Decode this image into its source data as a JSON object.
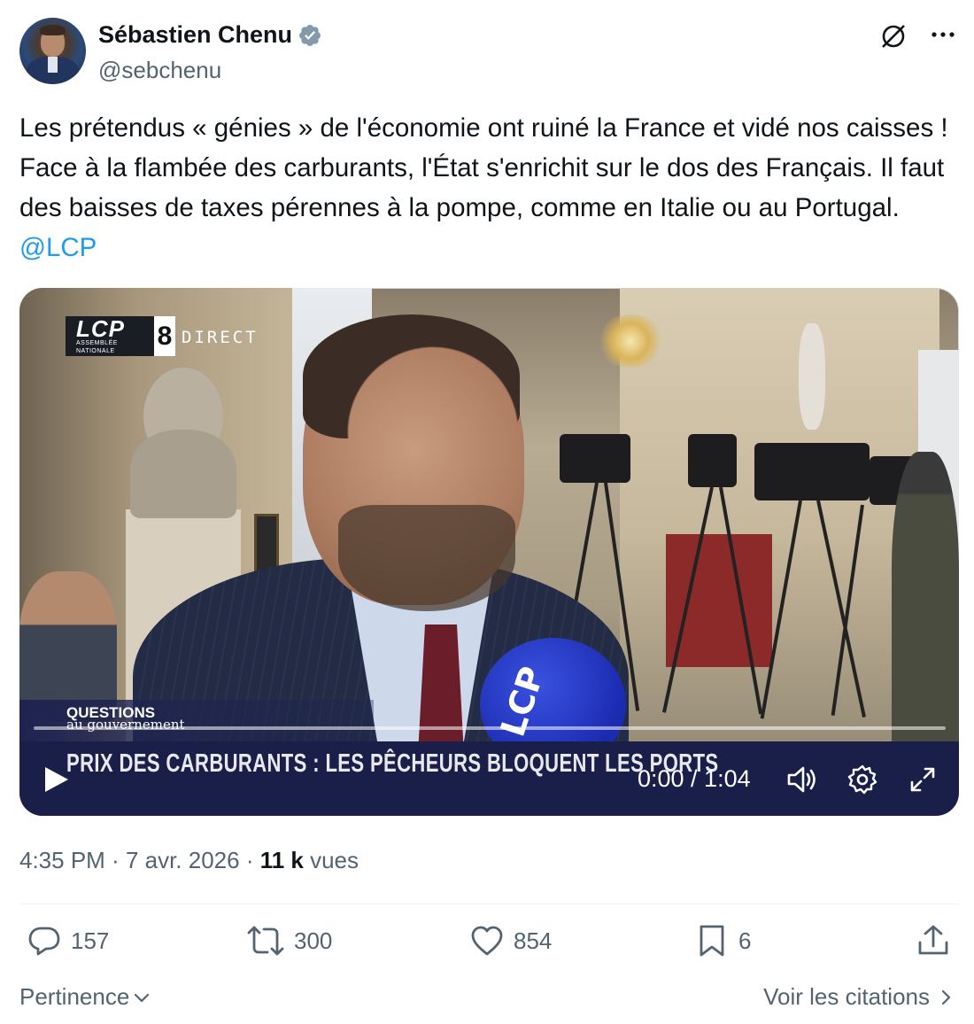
{
  "author": {
    "display_name": "Sébastien Chenu",
    "handle": "@sebchenu",
    "verified": true
  },
  "tweet": {
    "text_before_mention": "Les prétendus « génies » de l'économie ont ruiné la France et vidé nos caisses ! Face à la flambée des carburants, l'État s'enrichit sur le dos des Français. Il faut des baisses de taxes pérennes à la pompe, comme en Italie ou au Portugal. ",
    "mention": "@LCP"
  },
  "video": {
    "channel_logo": "LCP",
    "channel_logo_sub": "ASSEMBLÉE NATIONALE",
    "channel_number": "8",
    "live_label": "DIRECT",
    "program_line1": "QUESTIONS",
    "program_line2": "au gouvernement",
    "ticker": "PRIX DES CARBURANTS : LES PÊCHEURS BLOQUENT LES PORTS",
    "mic_label": "LCP",
    "time_display": "0:00 / 1:04",
    "progress": 0
  },
  "meta": {
    "time": "4:35 PM",
    "sep1": " · ",
    "date": "7 avr. 2026",
    "sep2": " · ",
    "views_count": "11 k",
    "views_label": " vues"
  },
  "actions": {
    "replies": "157",
    "reposts": "300",
    "likes": "854",
    "bookmarks": "6"
  },
  "footer": {
    "sort_label": "Pertinence",
    "quotes_label": "Voir les citations"
  },
  "icons": {
    "verified": "verified-badge-icon",
    "grok": "grok-icon",
    "more": "more-icon",
    "play": "play-icon",
    "volume": "volume-icon",
    "settings": "settings-icon",
    "fullscreen": "fullscreen-icon",
    "reply": "reply-icon",
    "repost": "repost-icon",
    "like": "heart-icon",
    "bookmark": "bookmark-icon",
    "share": "share-icon"
  },
  "colors": {
    "accent": "#1d9bf0",
    "text": "#0f1419",
    "muted": "#536471",
    "verified": "#829aab"
  }
}
